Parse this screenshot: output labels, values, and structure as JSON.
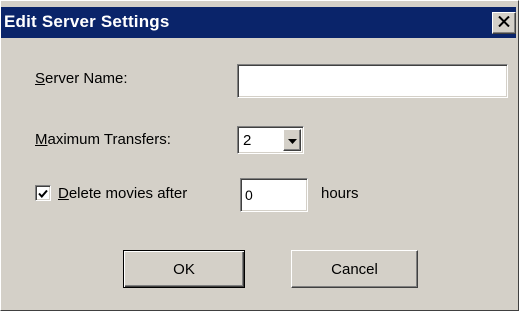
{
  "dialog": {
    "title": "Edit Server Settings",
    "close_icon": "close-x-icon"
  },
  "server_name": {
    "label_mnemonic": "S",
    "label_rest": "erver Name:",
    "value": ""
  },
  "max_transfers": {
    "label_mnemonic": "M",
    "label_rest": "aximum Transfers:",
    "selected": "2",
    "dropdown_icon": "dropdown-arrow-icon"
  },
  "delete_movies": {
    "checked": true,
    "label_mnemonic": "D",
    "label_rest": "elete movies after",
    "value": "0",
    "unit": "hours",
    "check_icon": "checkmark-icon"
  },
  "buttons": {
    "ok": "OK",
    "cancel": "Cancel"
  },
  "colors": {
    "titlebar": "#0a246a",
    "face": "#d4d0c8"
  }
}
